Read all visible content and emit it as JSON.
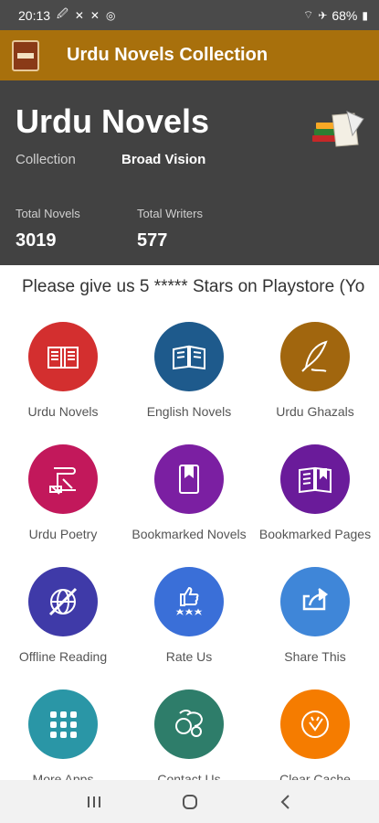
{
  "status_bar": {
    "time": "20:13",
    "battery": "68%"
  },
  "app_bar": {
    "title": "Urdu Novels Collection"
  },
  "header": {
    "title": "Urdu Novels",
    "collection_label": "Collection",
    "brand": "Broad Vision",
    "stats": [
      {
        "label": "Total Novels",
        "value": "3019"
      },
      {
        "label": "Total Writers",
        "value": "577"
      }
    ]
  },
  "marquee": "Please give us 5 ***** Stars on Playstore (Yo",
  "menu": [
    {
      "label": "Urdu Novels",
      "icon": "open-book-icon",
      "color": "#d32f2f"
    },
    {
      "label": "English Novels",
      "icon": "reading-book-icon",
      "color": "#1e5a8c"
    },
    {
      "label": "Urdu Ghazals",
      "icon": "quill-pen-icon",
      "color": "#a1660e"
    },
    {
      "label": "Urdu Poetry",
      "icon": "poetry-scroll-icon",
      "color": "#c2185b"
    },
    {
      "label": "Bookmarked Novels",
      "icon": "bookmark-book-icon",
      "color": "#7b1fa2"
    },
    {
      "label": "Bookmarked Pages",
      "icon": "bookmark-pages-icon",
      "color": "#6a1b9a"
    },
    {
      "label": "Offline Reading",
      "icon": "offline-globe-icon",
      "color": "#3f3aa8"
    },
    {
      "label": "Rate Us",
      "icon": "thumbs-up-stars-icon",
      "color": "#3a6fd8"
    },
    {
      "label": "Share This",
      "icon": "share-icon",
      "color": "#3f86d8"
    },
    {
      "label": "More Apps",
      "icon": "apps-grid-icon",
      "color": "#2a96a6"
    },
    {
      "label": "Contact Us",
      "icon": "contact-icon",
      "color": "#2e7d6a"
    },
    {
      "label": "Clear Cache",
      "icon": "clear-cache-icon",
      "color": "#f57c00"
    }
  ]
}
